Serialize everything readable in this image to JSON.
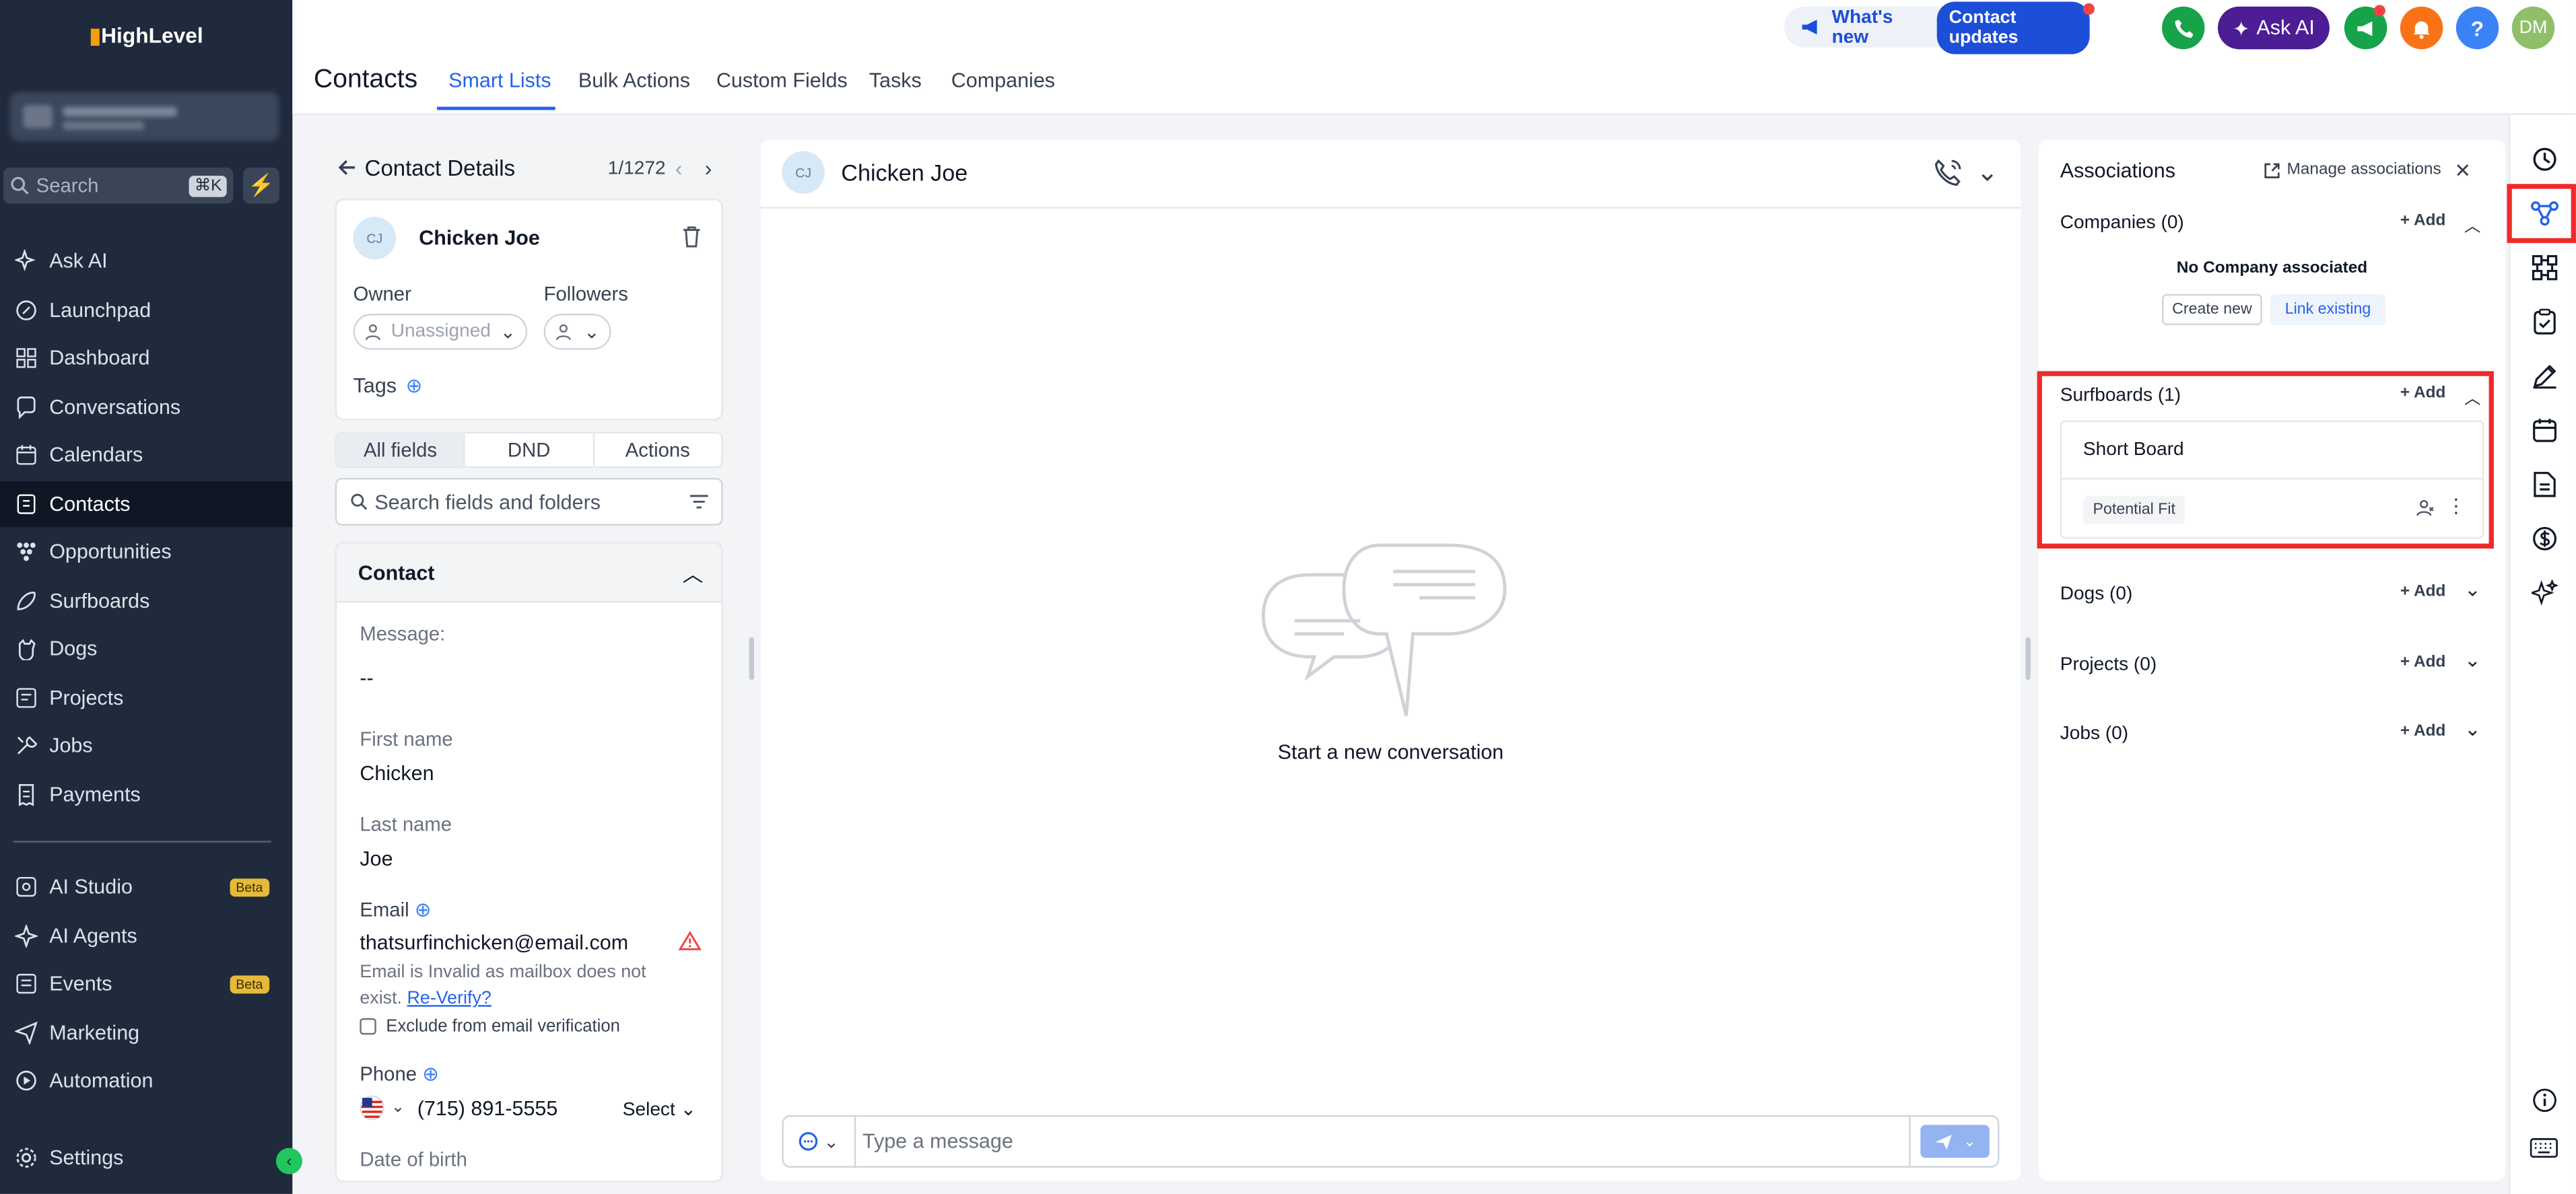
{
  "app": {
    "logo_text": "HighLevel"
  },
  "sidebar": {
    "search_placeholder": "Search",
    "search_shortcut": "⌘K",
    "items": [
      {
        "label": "Ask AI",
        "icon": "sparkle-icon"
      },
      {
        "label": "Launchpad",
        "icon": "rocket-icon"
      },
      {
        "label": "Dashboard",
        "icon": "grid-icon"
      },
      {
        "label": "Conversations",
        "icon": "chat-icon"
      },
      {
        "label": "Calendars",
        "icon": "calendar-icon"
      },
      {
        "label": "Contacts",
        "icon": "contact-book-icon",
        "active": true
      },
      {
        "label": "Opportunities",
        "icon": "funnel-icon"
      },
      {
        "label": "Surfboards",
        "icon": "surfboard-icon"
      },
      {
        "label": "Dogs",
        "icon": "dog-icon"
      },
      {
        "label": "Projects",
        "icon": "project-icon"
      },
      {
        "label": "Jobs",
        "icon": "tools-icon"
      },
      {
        "label": "Payments",
        "icon": "receipt-icon"
      }
    ],
    "items2": [
      {
        "label": "AI Studio",
        "icon": "ai-studio-icon",
        "badge": "Beta"
      },
      {
        "label": "AI Agents",
        "icon": "ai-agent-icon"
      },
      {
        "label": "Events",
        "icon": "events-icon",
        "badge": "Beta"
      },
      {
        "label": "Marketing",
        "icon": "send-icon"
      },
      {
        "label": "Automation",
        "icon": "automation-icon"
      }
    ],
    "settings": "Settings"
  },
  "header": {
    "title": "Contacts",
    "tabs": [
      "Smart Lists",
      "Bulk Actions",
      "Custom Fields",
      "Tasks",
      "Companies"
    ],
    "active_tab": "Smart Lists",
    "whats_new": "What's new",
    "contact_updates": "Contact updates",
    "ask_ai": "Ask AI",
    "user_initials": "DM"
  },
  "contact": {
    "panel_title": "Contact Details",
    "pager": "1/1272",
    "initials": "CJ",
    "name": "Chicken Joe",
    "owner_label": "Owner",
    "owner_value": "Unassigned",
    "followers_label": "Followers",
    "tags_label": "Tags",
    "tabs": [
      "All fields",
      "DND",
      "Actions"
    ],
    "search_placeholder": "Search fields and folders",
    "section_title": "Contact",
    "fields": {
      "message_label": "Message:",
      "message_value": "--",
      "first_name_label": "First name",
      "first_name_value": "Chicken",
      "last_name_label": "Last name",
      "last_name_value": "Joe",
      "email_label": "Email",
      "email_value": "thatsurfinchicken@email.com",
      "email_warning": "Email is Invalid as mailbox does not exist.",
      "reverify": "Re-Verify?",
      "exclude_label": "Exclude from email verification",
      "phone_label": "Phone",
      "phone_value": "(715) 891-5555",
      "phone_select": "Select",
      "dob_label": "Date of birth"
    }
  },
  "conversation": {
    "initials": "CJ",
    "name": "Chicken Joe",
    "empty_text": "Start a new conversation",
    "input_placeholder": "Type a message"
  },
  "associations": {
    "title": "Associations",
    "manage": "Manage associations",
    "add_label": "Add",
    "companies": {
      "title": "Companies (0)",
      "empty": "No Company associated",
      "create": "Create new",
      "link": "Link existing"
    },
    "surfboards": {
      "title": "Surfboards (1)",
      "item_name": "Short Board",
      "item_tag": "Potential Fit"
    },
    "dogs": {
      "title": "Dogs (0)"
    },
    "projects": {
      "title": "Projects (0)"
    },
    "jobs": {
      "title": "Jobs (0)"
    }
  },
  "colors": {
    "accent": "#2563eb",
    "sidebar_bg": "#1f2a3c",
    "highlight": "#ef2a2a",
    "ask_ai": "#4c1d95",
    "phone": "#16a34a"
  }
}
